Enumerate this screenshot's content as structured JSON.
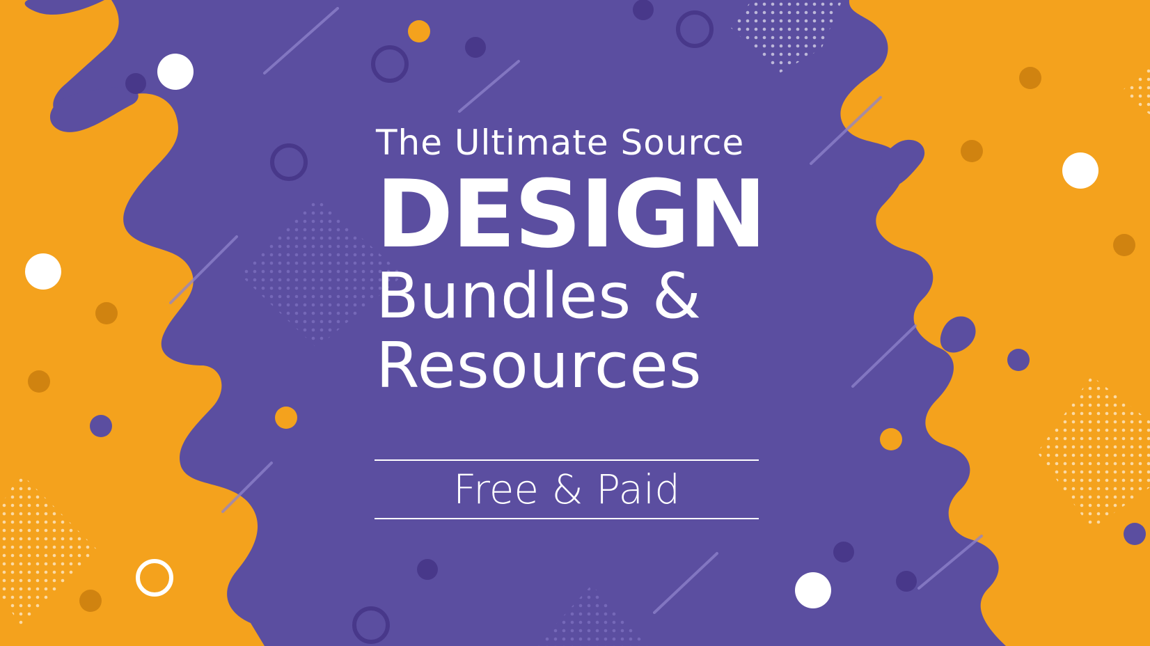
{
  "banner": {
    "line1": "The Ultimate Source",
    "line2": "DESIGN",
    "line3": "Bundles &",
    "line4": "Resources",
    "tagline": "Free & Paid"
  },
  "colors": {
    "background_purple": "#5b4ea0",
    "accent_orange": "#f4a21d",
    "dot_dark_orange": "#d08310",
    "dot_dark_purple": "#48388a",
    "text_white": "#ffffff"
  }
}
